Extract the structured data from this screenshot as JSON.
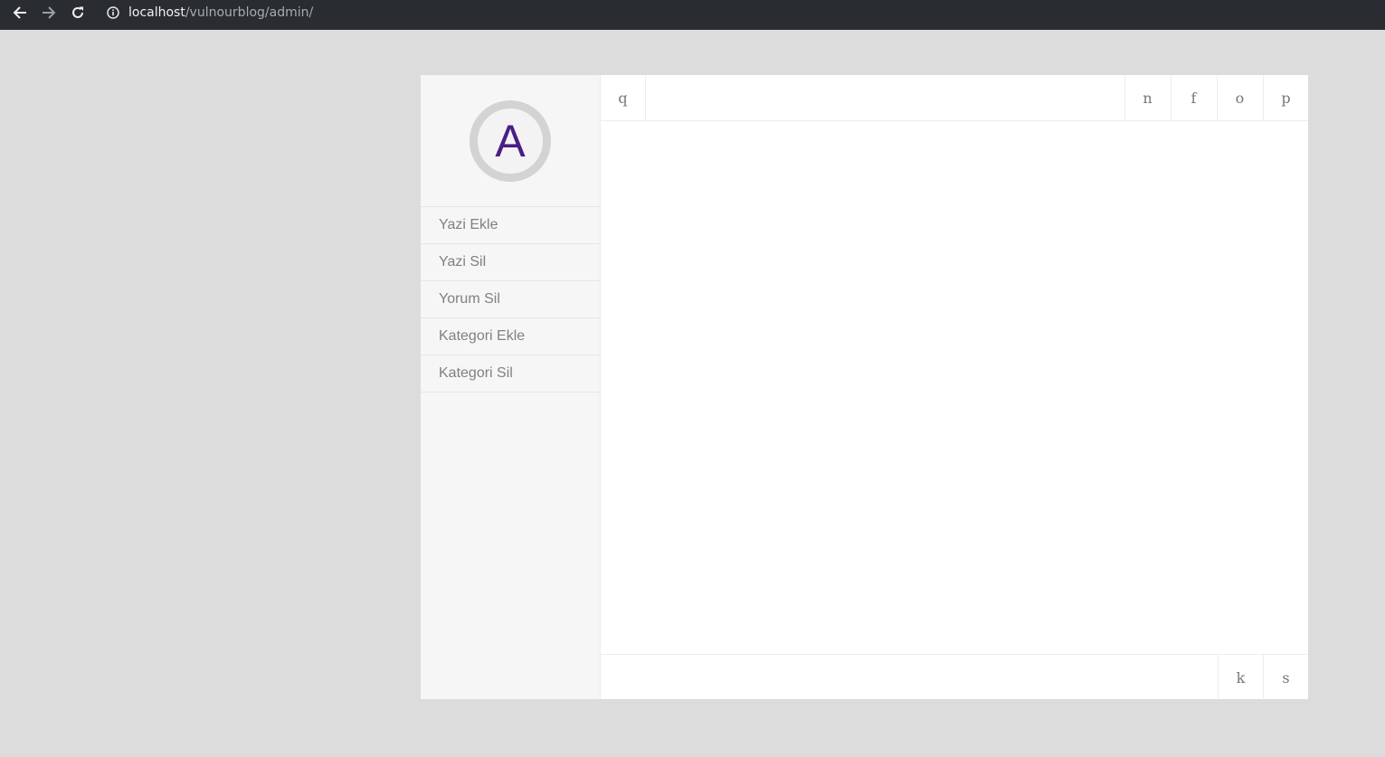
{
  "browser": {
    "url_host": "localhost",
    "url_path": "/vulnourblog/admin/",
    "icons": [
      "back-icon",
      "forward-icon",
      "reload-icon",
      "info-icon"
    ]
  },
  "sidebar": {
    "avatar_letter": "A",
    "avatar_color": "#4b1d86",
    "items": [
      {
        "label": "Yazi Ekle"
      },
      {
        "label": "Yazi Sil"
      },
      {
        "label": "Yorum Sil"
      },
      {
        "label": "Kategori Ekle"
      },
      {
        "label": "Kategori Sil"
      }
    ]
  },
  "topbar": {
    "left_button": "q",
    "right_buttons": [
      "n",
      "f",
      "o",
      "p"
    ]
  },
  "bottombar": {
    "right_buttons": [
      "k",
      "s"
    ]
  }
}
